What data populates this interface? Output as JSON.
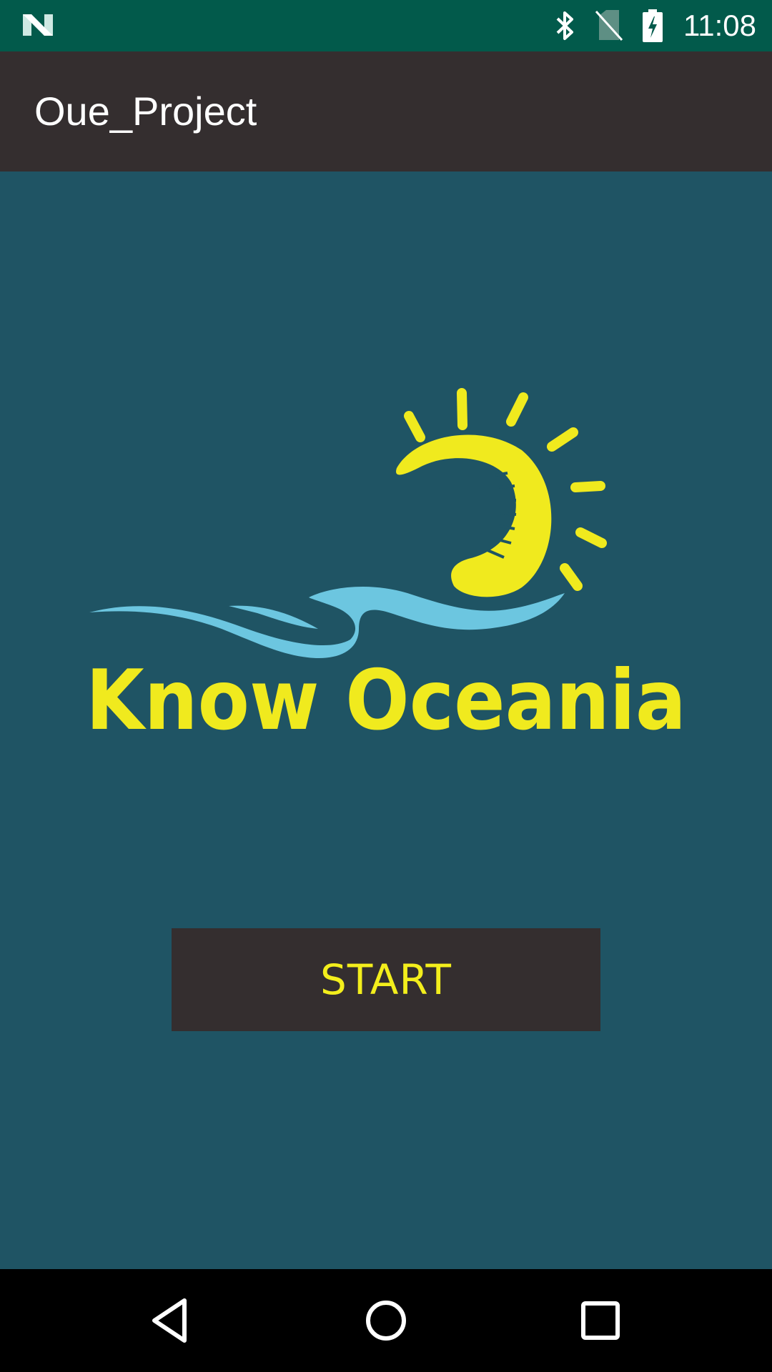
{
  "status_bar": {
    "time": "11:08",
    "icons": [
      "notification-n-icon",
      "bluetooth-icon",
      "no-sim-icon",
      "battery-charging-icon"
    ],
    "background_color": "#025a4b"
  },
  "app_bar": {
    "title": "Oue_Project",
    "background_color": "#342e2f"
  },
  "main": {
    "background_color": "#1f5464",
    "logo": {
      "text": "Know Oceania",
      "icon": "sun-wave-logo",
      "colors": {
        "sun": "#f0ea1e",
        "wave": "#6cc6e0",
        "text": "#f0ea1e"
      }
    },
    "start_button": {
      "label": "START",
      "text_color": "#f3ee1c",
      "background_color": "#342e2f"
    }
  },
  "nav_bar": {
    "buttons": [
      "back-icon",
      "home-icon",
      "recents-icon"
    ]
  }
}
